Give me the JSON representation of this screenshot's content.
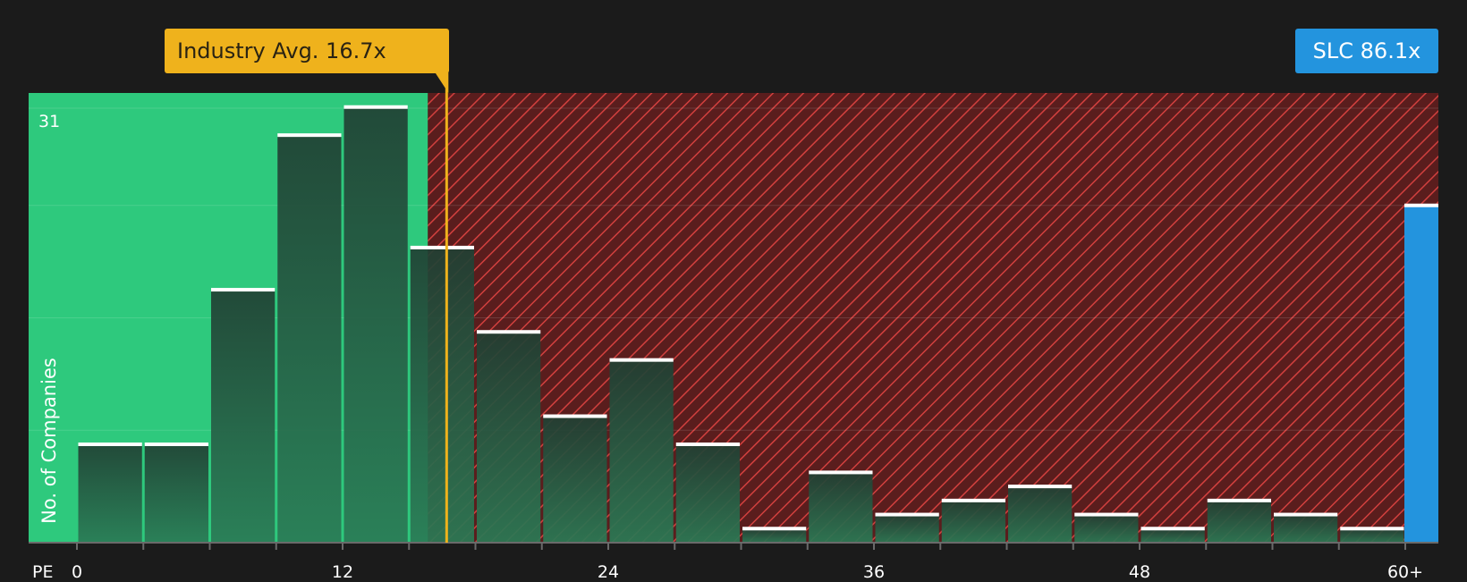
{
  "chart_data": {
    "type": "bar",
    "xlabel": "PE",
    "ylabel": "No. of Companies",
    "ylim": [
      0,
      32
    ],
    "y_tick_label": "31",
    "x_ticks": [
      "0",
      "12",
      "24",
      "36",
      "48",
      "60+"
    ],
    "bins": [
      {
        "start": 0,
        "end": 3,
        "value": 7
      },
      {
        "start": 3,
        "end": 6,
        "value": 7
      },
      {
        "start": 6,
        "end": 9,
        "value": 18
      },
      {
        "start": 9,
        "end": 12,
        "value": 29
      },
      {
        "start": 12,
        "end": 15,
        "value": 31
      },
      {
        "start": 15,
        "end": 18,
        "value": 21
      },
      {
        "start": 18,
        "end": 21,
        "value": 15
      },
      {
        "start": 21,
        "end": 24,
        "value": 9
      },
      {
        "start": 24,
        "end": 27,
        "value": 13
      },
      {
        "start": 27,
        "end": 30,
        "value": 7
      },
      {
        "start": 30,
        "end": 33,
        "value": 1
      },
      {
        "start": 33,
        "end": 36,
        "value": 5
      },
      {
        "start": 36,
        "end": 39,
        "value": 2
      },
      {
        "start": 39,
        "end": 42,
        "value": 3
      },
      {
        "start": 42,
        "end": 45,
        "value": 4
      },
      {
        "start": 45,
        "end": 48,
        "value": 2
      },
      {
        "start": 48,
        "end": 51,
        "value": 1
      },
      {
        "start": 51,
        "end": 54,
        "value": 3
      },
      {
        "start": 54,
        "end": 57,
        "value": 2
      },
      {
        "start": 57,
        "end": 60,
        "value": 1
      }
    ],
    "industry_avg": {
      "value": 16.7,
      "label": "Industry Avg. 16.7x"
    },
    "company": {
      "name": "SLC",
      "value": 86.1,
      "label": "SLC 86.1x",
      "bar_height": 24
    },
    "colors": {
      "fair_region": "#2ec97d",
      "overvalued_region": "#5a1d1d",
      "overvalued_hatch": "#d2403e",
      "bar_fill_top": "#213f33",
      "bar_fill_bottom": "#2a7a55",
      "bar_cap": "#ffffff",
      "industry": "#efb21c",
      "company": "#2394de"
    }
  }
}
